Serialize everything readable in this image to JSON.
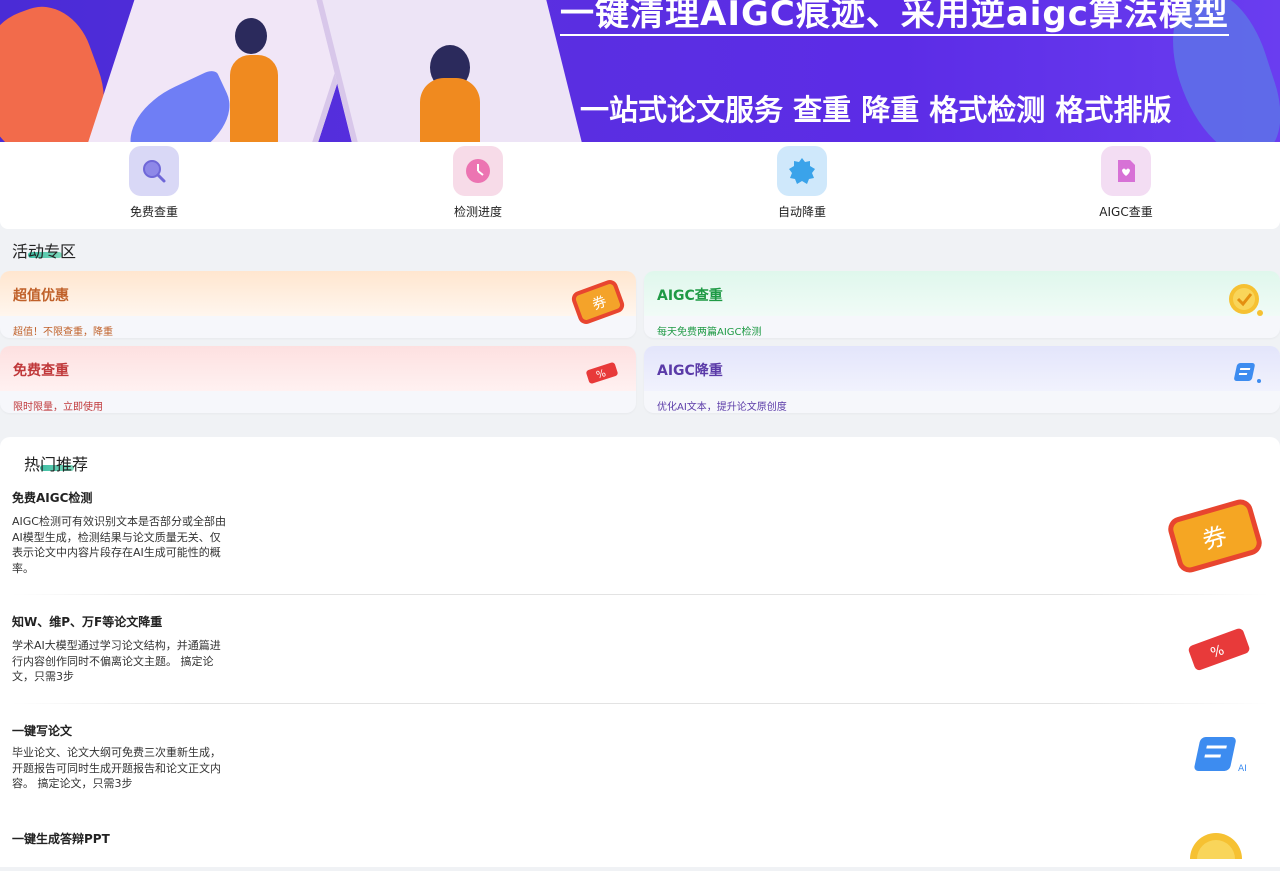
{
  "banner": {
    "headline": "一键清理AIGC痕迹、采用逆aigc算法模型",
    "subline": "一站式论文服务 查重 降重 格式检测 格式排版"
  },
  "quicknav": [
    {
      "label": "免费查重",
      "icon": "search-icon"
    },
    {
      "label": "检测进度",
      "icon": "clock-icon"
    },
    {
      "label": "自动降重",
      "icon": "moon-icon"
    },
    {
      "label": "AIGC查重",
      "icon": "document-icon"
    }
  ],
  "activity": {
    "title": "活动专区",
    "cards": [
      {
        "title": "超值优惠",
        "subtitle": "超值！不限查重，降重",
        "icon": "coupon-icon"
      },
      {
        "title": "AIGC查重",
        "subtitle": "每天免费两篇AIGC检测",
        "icon": "coin-icon"
      },
      {
        "title": "免费查重",
        "subtitle": "限时限量，立即使用",
        "icon": "ticket-icon"
      },
      {
        "title": "AIGC降重",
        "subtitle": "优化AI文本，提升论文原创度",
        "icon": "ai-doc-icon"
      }
    ]
  },
  "hot": {
    "title": "热门推荐",
    "items": [
      {
        "title": "免费AIGC检测",
        "desc": "AIGC检测可有效识别文本是否部分或全部由AI模型生成，检测结果与论文质量无关、仅表示论文中内容片段存在AI生成可能性的概率。",
        "icon": "coupon-icon"
      },
      {
        "title": "知W、维P、万F等论文降重",
        "desc": "学术AI大模型通过学习论文结构，并通篇进行内容创作同时不偏离论文主题。 搞定论文，只需3步",
        "icon": "ticket-icon"
      },
      {
        "title": "一键写论文",
        "desc": "毕业论文、论文大纲可免费三次重新生成，开题报告可同时生成开题报告和论文正文内容。 搞定论文，只需3步",
        "icon": "ai-doc-icon"
      },
      {
        "title": "一键生成答辩PPT",
        "desc": "",
        "icon": "coin-icon"
      }
    ]
  },
  "colors": {
    "banner_bg": "#5a2fe0",
    "card1": "#c0612a",
    "card2": "#1f9a45",
    "card3": "#c0393b",
    "card4": "#5b3ba8",
    "accent_underline": "#28b79a"
  }
}
